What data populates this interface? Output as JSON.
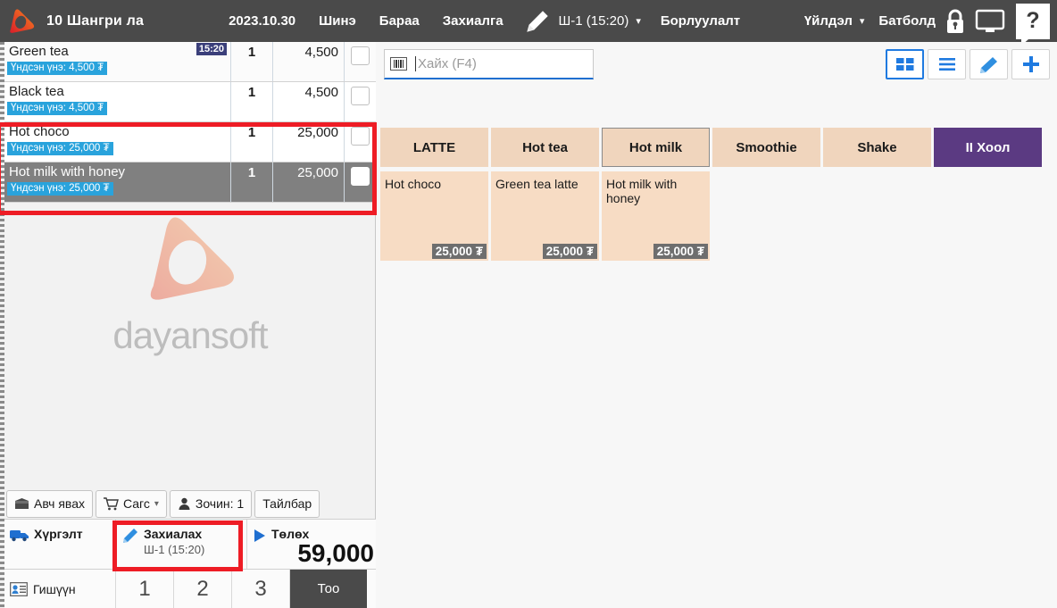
{
  "header": {
    "logo_icon": "dayansoft-play-logo",
    "branch": "10 Шангри ла",
    "date": "2023.10.30",
    "menu": {
      "new": "Шинэ",
      "goods": "Бараа",
      "order": "Захиалга"
    },
    "pencil_icon": "pencil-icon",
    "shift": "Ш-1 (15:20)",
    "shift_chevron": "chevron-down-icon",
    "sale": "Борлуулалт",
    "action": "Үйлдэл",
    "action_chevron": "chevron-down-icon",
    "user": "Батболд",
    "lock_icon": "lock-icon",
    "monitor_icon": "monitor-icon",
    "help_label": "?"
  },
  "order": {
    "rows": [
      {
        "name": "Green tea",
        "base_price": "Үндсэн үнэ: 4,500 ₮",
        "qty": "1",
        "price": "4,500",
        "time": "15:20",
        "selected": false
      },
      {
        "name": "Black tea",
        "base_price": "Үндсэн үнэ: 4,500 ₮",
        "qty": "1",
        "price": "4,500",
        "time": "",
        "selected": false
      },
      {
        "name": "Hot choco",
        "base_price": "Үндсэн үнэ: 25,000 ₮",
        "qty": "1",
        "price": "25,000",
        "time": "",
        "selected": false
      },
      {
        "name": "Hot milk with honey",
        "base_price": "Үндсэн үнэ: 25,000 ₮",
        "qty": "1",
        "price": "25,000",
        "time": "",
        "selected": true
      }
    ]
  },
  "watermark": {
    "text": "dayansoft",
    "logo_icon": "dayansoft-play-logo"
  },
  "bottom_toolbar": {
    "takeaway": {
      "label": "Авч явах",
      "icon": "takeaway-box-icon"
    },
    "cart": {
      "label": "Сагс",
      "icon": "cart-icon",
      "chevron": "chevron-down-icon"
    },
    "guest": {
      "label": "Зочин: 1",
      "icon": "person-icon"
    },
    "note": {
      "label": "Тайлбар"
    },
    "delivery": {
      "label": "Хүргэлт",
      "icon": "truck-icon"
    },
    "place_order": {
      "label": "Захиалах",
      "sub": "Ш-1 (15:20)",
      "icon": "pencil-icon"
    },
    "pay": {
      "label": "Төлөх",
      "icon": "play-triangle-icon",
      "amount": "59,000"
    },
    "member": {
      "label": "Гишүүн",
      "icon": "id-card-icon"
    },
    "numpad": [
      "1",
      "2",
      "3"
    ],
    "qty_key": "Тоо"
  },
  "catalog": {
    "search": {
      "placeholder": "Хайх (F4)",
      "value": "",
      "icon": "barcode-icon"
    },
    "view_tools": [
      {
        "name": "grid-view",
        "icon": "grid-icon",
        "active": true
      },
      {
        "name": "list-view",
        "icon": "list-icon",
        "active": false
      },
      {
        "name": "edit",
        "icon": "pencil-icon",
        "active": false
      },
      {
        "name": "add",
        "icon": "plus-icon",
        "active": false
      }
    ],
    "categories": [
      {
        "label": "LATTE",
        "selected": false,
        "accent": false
      },
      {
        "label": "Hot tea",
        "selected": false,
        "accent": false
      },
      {
        "label": "Hot milk",
        "selected": true,
        "accent": false
      },
      {
        "label": "Smoothie",
        "selected": false,
        "accent": false
      },
      {
        "label": "Shake",
        "selected": false,
        "accent": false
      },
      {
        "label": "II Хоол",
        "selected": false,
        "accent": true
      }
    ],
    "products": [
      {
        "name": "Hot choco",
        "price": "25,000 ₮"
      },
      {
        "name": "Green tea latte",
        "price": "25,000 ₮"
      },
      {
        "name": "Hot milk with honey",
        "price": "25,000 ₮"
      }
    ]
  },
  "annotations": {
    "color": "#ee1c25",
    "boxes": [
      {
        "name": "highlight-order-items"
      },
      {
        "name": "highlight-place-order-button"
      }
    ]
  }
}
